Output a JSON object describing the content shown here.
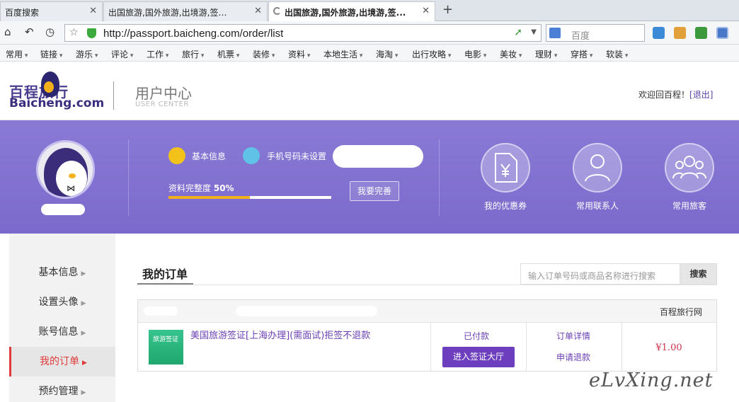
{
  "browser": {
    "tabs": [
      {
        "title": "百度搜索",
        "active": false
      },
      {
        "title": "出国旅游,国外旅游,出境游,签证首...",
        "active": false
      },
      {
        "title": "出国旅游,国外旅游,出境游,签...",
        "active": true
      }
    ],
    "new_tab": "+",
    "url": "http://passport.baicheng.com/order/list",
    "search_placeholder": "百度",
    "bookmarks": [
      "常用",
      "链接",
      "游乐",
      "评论",
      "工作",
      "旅行",
      "机票",
      "装修",
      "资料",
      "本地生活",
      "海淘",
      "出行攻略",
      "电影",
      "美妆",
      "理财",
      "穿搭",
      "软装"
    ]
  },
  "header": {
    "logo_cn": "百程旅行",
    "logo_en": "Baicheng.com",
    "section_cn": "用户中心",
    "section_en": "USER CENTER",
    "welcome": "欢迎回百程！",
    "logout": "[退出]"
  },
  "profile": {
    "basic_info": "基本信息",
    "phone_status": "手机号码未设置",
    "completeness_label": "资料完整度",
    "completeness_value": "50%",
    "completeness_fraction": 0.5,
    "improve_button": "我要完善",
    "quick_links": [
      {
        "label": "我的优惠券",
        "icon": "coupon-icon"
      },
      {
        "label": "常用联系人",
        "icon": "contact-icon"
      },
      {
        "label": "常用旅客",
        "icon": "travelers-icon"
      }
    ]
  },
  "sidebar": {
    "items": [
      {
        "label": "基本信息",
        "active": false
      },
      {
        "label": "设置头像",
        "active": false
      },
      {
        "label": "账号信息",
        "active": false
      },
      {
        "label": "我的订单",
        "active": true
      },
      {
        "label": "预约管理",
        "active": false
      }
    ]
  },
  "orders": {
    "title": "我的订单",
    "search_placeholder": "输入订单号码或商品名称进行搜索",
    "search_button": "搜索",
    "list": [
      {
        "merchant": "百程旅行网",
        "product_image_text": "旅游签证",
        "product_title": "美国旅游签证[上海办理](需面试)拒签不退款",
        "status": "已付款",
        "action_button": "进入签证大厅",
        "detail_link": "订单详情",
        "refund_link": "申请退款",
        "price": "¥1.00"
      }
    ]
  },
  "watermark": "eLvXing.net",
  "colors": {
    "banner": "#7b6acb",
    "accent": "#6d3fbf",
    "price": "#d0314a",
    "progress": "#f2b01b"
  }
}
